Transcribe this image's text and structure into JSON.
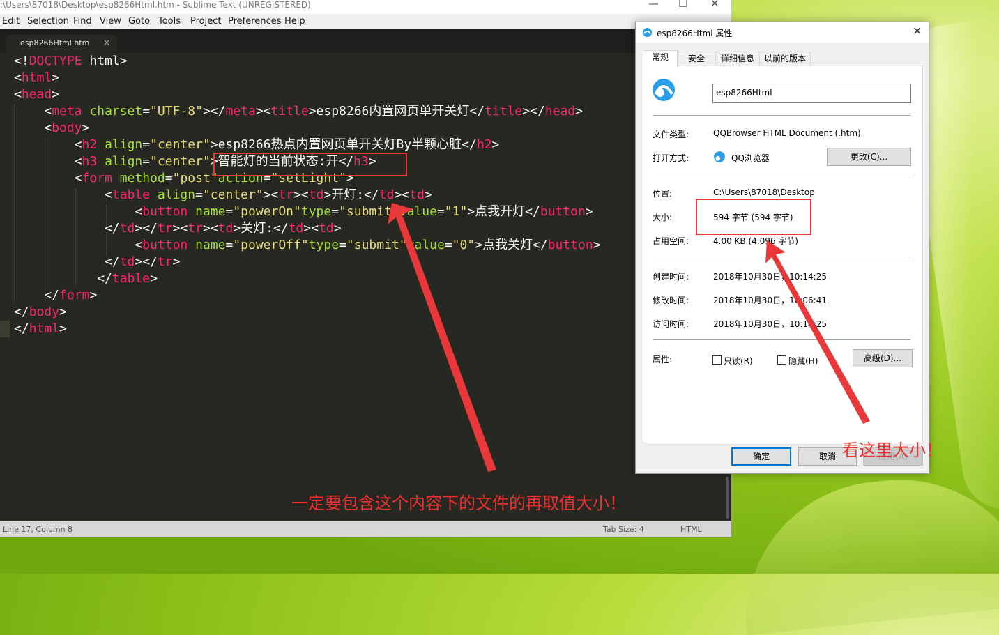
{
  "editor": {
    "window_title": ":\\Users\\87018\\Desktop\\esp8266Html.htm - Sublime Text (UNREGISTERED)",
    "window_controls": {
      "minimize": "—",
      "maximize": "☐",
      "close": "✕"
    },
    "menu": [
      "Edit",
      "Selection",
      "Find",
      "View",
      "Goto",
      "Tools",
      "Project",
      "Preferences",
      "Help"
    ],
    "tab": {
      "label": "esp8266Html.htm",
      "close": "×"
    },
    "status": {
      "position": "Line 17, Column 8",
      "tab_size": "Tab Size: 4",
      "syntax": "HTML"
    }
  },
  "code_lines": [
    [
      [
        "p",
        "<!"
      ],
      [
        "t",
        "DOCTYPE"
      ],
      [
        "p",
        " html>"
      ]
    ],
    [
      [
        "p",
        "<"
      ],
      [
        "t",
        "html"
      ],
      [
        "p",
        ">"
      ]
    ],
    [
      [
        "p",
        "<"
      ],
      [
        "t",
        "head"
      ],
      [
        "p",
        ">"
      ]
    ],
    [
      [
        "p",
        "    <"
      ],
      [
        "t",
        "meta"
      ],
      [
        "p",
        " "
      ],
      [
        "a",
        "charset"
      ],
      [
        "p",
        "="
      ],
      [
        "s",
        "\"UTF-8\""
      ],
      [
        "p",
        "></"
      ],
      [
        "t",
        "meta"
      ],
      [
        "p",
        "><"
      ],
      [
        "t",
        "title"
      ],
      [
        "p",
        ">esp8266内置网页单开关灯</"
      ],
      [
        "t",
        "title"
      ],
      [
        "p",
        "></"
      ],
      [
        "t",
        "head"
      ],
      [
        "p",
        ">"
      ]
    ],
    [
      [
        "p",
        "    <"
      ],
      [
        "t",
        "body"
      ],
      [
        "p",
        ">"
      ]
    ],
    [
      [
        "p",
        "        <"
      ],
      [
        "t",
        "h2"
      ],
      [
        "p",
        " "
      ],
      [
        "a",
        "align"
      ],
      [
        "p",
        "="
      ],
      [
        "s",
        "\"center\""
      ],
      [
        "p",
        ">esp8266热点内置网页单开关灯By半颗心脏</"
      ],
      [
        "t",
        "h2"
      ],
      [
        "p",
        ">"
      ]
    ],
    [
      [
        "p",
        "        <"
      ],
      [
        "t",
        "h3"
      ],
      [
        "p",
        " "
      ],
      [
        "a",
        "align"
      ],
      [
        "p",
        "="
      ],
      [
        "s",
        "\"center\""
      ],
      [
        "p",
        ">智能灯的当前状态:开</"
      ],
      [
        "t",
        "h3"
      ],
      [
        "p",
        ">"
      ]
    ],
    [
      [
        "p",
        "        <"
      ],
      [
        "t",
        "form"
      ],
      [
        "p",
        " "
      ],
      [
        "a",
        "method"
      ],
      [
        "p",
        "="
      ],
      [
        "s",
        "\"post\""
      ],
      [
        "a",
        "action"
      ],
      [
        "p",
        "="
      ],
      [
        "s",
        "\"setLight\""
      ],
      [
        "p",
        ">"
      ]
    ],
    [
      [
        "p",
        "            <"
      ],
      [
        "t",
        "table"
      ],
      [
        "p",
        " "
      ],
      [
        "a",
        "align"
      ],
      [
        "p",
        "="
      ],
      [
        "s",
        "\"center\""
      ],
      [
        "p",
        "><"
      ],
      [
        "t",
        "tr"
      ],
      [
        "p",
        "><"
      ],
      [
        "t",
        "td"
      ],
      [
        "p",
        ">开灯:</"
      ],
      [
        "t",
        "td"
      ],
      [
        "p",
        "><"
      ],
      [
        "t",
        "td"
      ],
      [
        "p",
        ">"
      ]
    ],
    [
      [
        "p",
        "                <"
      ],
      [
        "t",
        "button"
      ],
      [
        "p",
        " "
      ],
      [
        "a",
        "name"
      ],
      [
        "p",
        "="
      ],
      [
        "s",
        "\"powerOn\""
      ],
      [
        "a",
        "type"
      ],
      [
        "p",
        "="
      ],
      [
        "s",
        "\"submit\""
      ],
      [
        "a",
        "value"
      ],
      [
        "p",
        "="
      ],
      [
        "s",
        "\"1\""
      ],
      [
        "p",
        ">点我开灯</"
      ],
      [
        "t",
        "button"
      ],
      [
        "p",
        ">"
      ]
    ],
    [
      [
        "p",
        "            </"
      ],
      [
        "t",
        "td"
      ],
      [
        "p",
        "></"
      ],
      [
        "t",
        "tr"
      ],
      [
        "p",
        "><"
      ],
      [
        "t",
        "tr"
      ],
      [
        "p",
        "><"
      ],
      [
        "t",
        "td"
      ],
      [
        "p",
        ">关灯:</"
      ],
      [
        "t",
        "td"
      ],
      [
        "p",
        "><"
      ],
      [
        "t",
        "td"
      ],
      [
        "p",
        ">"
      ]
    ],
    [
      [
        "p",
        "                <"
      ],
      [
        "t",
        "button"
      ],
      [
        "p",
        " "
      ],
      [
        "a",
        "name"
      ],
      [
        "p",
        "="
      ],
      [
        "s",
        "\"powerOff\""
      ],
      [
        "a",
        "type"
      ],
      [
        "p",
        "="
      ],
      [
        "s",
        "\"submit\""
      ],
      [
        "a",
        "value"
      ],
      [
        "p",
        "="
      ],
      [
        "s",
        "\"0\""
      ],
      [
        "p",
        ">点我关灯</"
      ],
      [
        "t",
        "button"
      ],
      [
        "p",
        ">"
      ]
    ],
    [
      [
        "p",
        "            </"
      ],
      [
        "t",
        "td"
      ],
      [
        "p",
        "></"
      ],
      [
        "t",
        "tr"
      ],
      [
        "p",
        ">"
      ]
    ],
    [
      [
        "p",
        "           </"
      ],
      [
        "t",
        "table"
      ],
      [
        "p",
        ">"
      ]
    ],
    [
      [
        "p",
        "    </"
      ],
      [
        "t",
        "form"
      ],
      [
        "p",
        ">"
      ]
    ],
    [
      [
        "p",
        "</"
      ],
      [
        "t",
        "body"
      ],
      [
        "p",
        ">"
      ]
    ],
    [
      [
        "p",
        "</"
      ],
      [
        "t",
        "html"
      ],
      [
        "p",
        ">"
      ]
    ]
  ],
  "dialog": {
    "title": "esp8266Html 属性",
    "close": "✕",
    "tabs": [
      "常规",
      "安全",
      "详细信息",
      "以前的版本"
    ],
    "file_name": "esp8266Html",
    "type_label": "文件类型:",
    "type_value": "QQBrowser HTML Document (.htm)",
    "open_with_label": "打开方式:",
    "open_with_value": "QQ浏览器",
    "change_button": "更改(C)...",
    "location_label": "位置:",
    "location_value": "C:\\Users\\87018\\Desktop",
    "size_label": "大小:",
    "size_value": "594 字节 (594 字节)",
    "disk_label": "占用空间:",
    "disk_value": "4.00 KB (4,096 字节)",
    "created_label": "创建时间:",
    "created_value": "2018年10月30日，10:14:25",
    "modified_label": "修改时间:",
    "modified_value": "2018年10月30日，16:06:41",
    "accessed_label": "访问时间:",
    "accessed_value": "2018年10月30日，10:14:25",
    "attr_label": "属性:",
    "readonly": "只读(R)",
    "hidden": "隐藏(H)",
    "advanced_button": "高级(D)...",
    "ok": "确定",
    "cancel": "取消",
    "apply": "应用(A)"
  },
  "annotations": {
    "bottom_text": "一定要包含这个内容下的文件的再取值大小！",
    "right_text": "看这里大小！"
  },
  "colors": {
    "tag": "#f92672",
    "attr": "#a6e22e",
    "string": "#e6db74",
    "plain": "#f8f8f2",
    "annotation": "#e8383a"
  }
}
